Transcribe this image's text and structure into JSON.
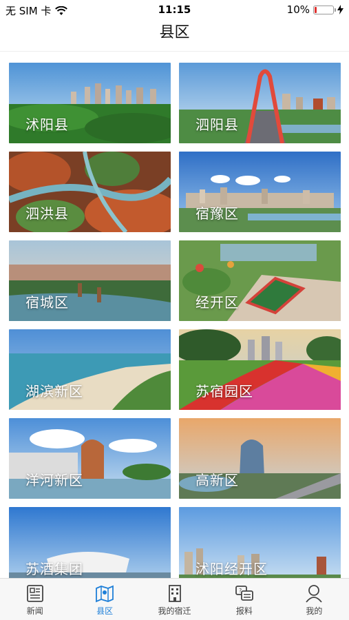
{
  "status": {
    "carrier": "无 SIM 卡",
    "time": "11:15",
    "battery": "10%",
    "battery_level": 0.1
  },
  "header": {
    "title": "县区"
  },
  "cards": [
    {
      "label": "沭阳县"
    },
    {
      "label": "泗阳县"
    },
    {
      "label": "泗洪县"
    },
    {
      "label": "宿豫区"
    },
    {
      "label": "宿城区"
    },
    {
      "label": "经开区"
    },
    {
      "label": "湖滨新区"
    },
    {
      "label": "苏宿园区"
    },
    {
      "label": "洋河新区"
    },
    {
      "label": "高新区"
    },
    {
      "label": "苏酒集团"
    },
    {
      "label": "沭阳经开区"
    }
  ],
  "tabs": [
    {
      "label": "新闻",
      "icon": "newspaper-icon"
    },
    {
      "label": "县区",
      "icon": "map-icon"
    },
    {
      "label": "我的宿迁",
      "icon": "building-icon"
    },
    {
      "label": "报料",
      "icon": "report-icon"
    },
    {
      "label": "我的",
      "icon": "person-icon"
    }
  ],
  "colors": {
    "accent": "#1e7fd8",
    "battery_low": "#e0312f"
  }
}
